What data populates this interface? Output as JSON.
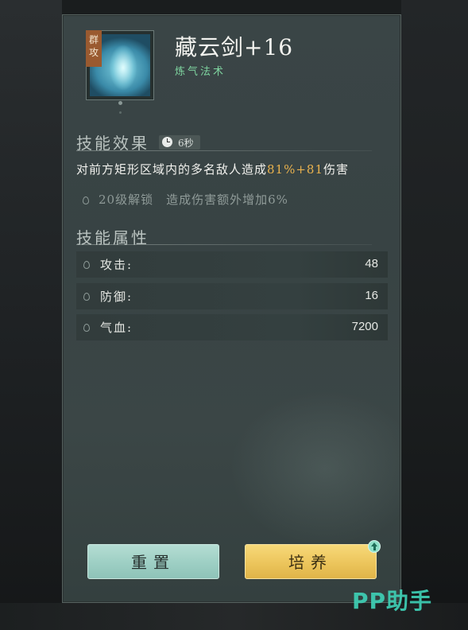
{
  "skill": {
    "tag_chars": [
      "群",
      "攻"
    ],
    "name": "藏云剑+16",
    "type": "炼气法术"
  },
  "effect": {
    "section_title": "技能效果",
    "cooldown": "6秒",
    "desc_prefix": "对前方矩形区域内的多名敌人造成",
    "desc_pct": "81%",
    "desc_plus": "+81",
    "desc_suffix": "伤害",
    "unlock_level": "20级解锁",
    "unlock_desc": "造成伤害额外增加6%"
  },
  "attributes": {
    "section_title": "技能属性",
    "rows": [
      {
        "label": "攻击:",
        "value": "48"
      },
      {
        "label": "防御:",
        "value": "16"
      },
      {
        "label": "气血:",
        "value": "7200"
      }
    ]
  },
  "buttons": {
    "reset_label": "重置",
    "train_label": "培养"
  },
  "watermark": "PP助手",
  "colors": {
    "highlight": "#e9b24e",
    "type_green": "#7fd4a0",
    "reset_button": "#a4d4c9",
    "train_button": "#ecc55c"
  }
}
